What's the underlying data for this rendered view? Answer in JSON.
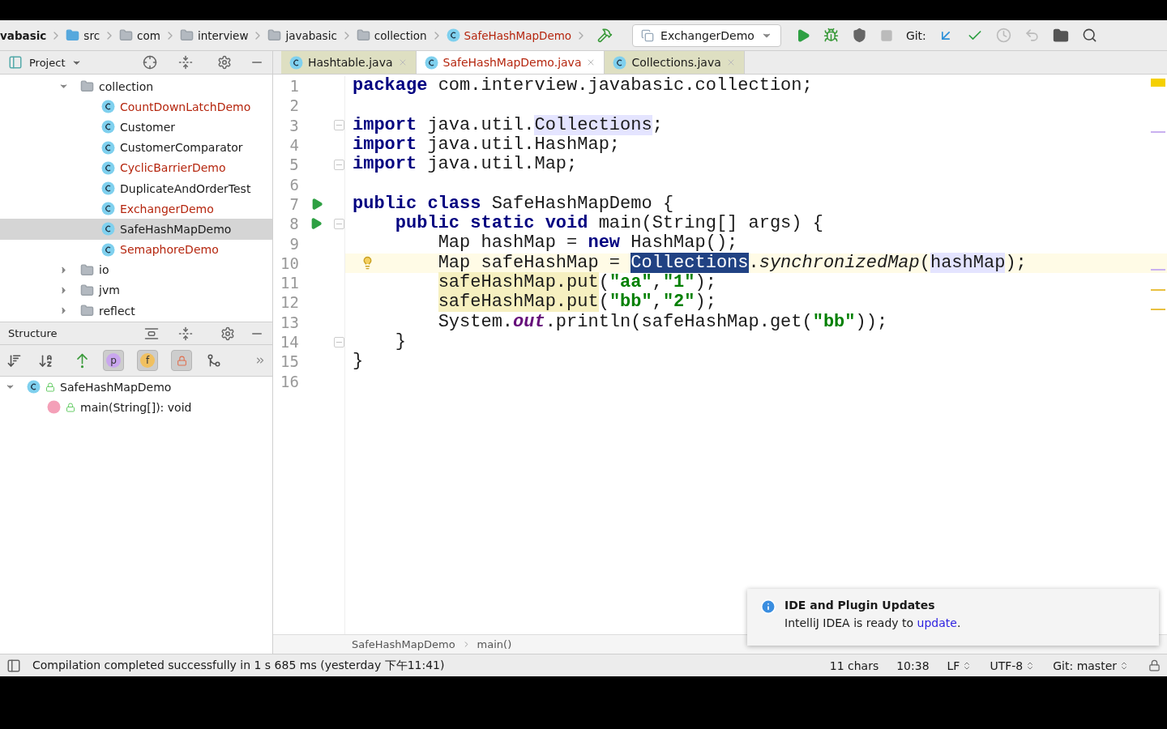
{
  "breadcrumbs": [
    {
      "label": "vabasic",
      "kind": "module"
    },
    {
      "label": "src",
      "kind": "source-folder"
    },
    {
      "label": "com",
      "kind": "package"
    },
    {
      "label": "interview",
      "kind": "package"
    },
    {
      "label": "javabasic",
      "kind": "package"
    },
    {
      "label": "collection",
      "kind": "package"
    },
    {
      "label": "SafeHashMapDemo",
      "kind": "class"
    }
  ],
  "run_config": "ExchangerDemo",
  "git_label": "Git:",
  "project_panel": {
    "title": "Project",
    "tree": [
      {
        "label": "collection",
        "expanded": true,
        "children": [
          {
            "label": "CountDownLatchDemo",
            "color": "#b5260e",
            "selected": false
          },
          {
            "label": "Customer",
            "color": "#1a1a1a",
            "selected": false
          },
          {
            "label": "CustomerComparator",
            "color": "#1a1a1a",
            "selected": false
          },
          {
            "label": "CyclicBarrierDemo",
            "color": "#b5260e",
            "selected": false
          },
          {
            "label": "DuplicateAndOrderTest",
            "color": "#1a1a1a",
            "selected": false
          },
          {
            "label": "ExchangerDemo",
            "color": "#b5260e",
            "selected": false
          },
          {
            "label": "SafeHashMapDemo",
            "color": "#1a1a1a",
            "selected": true
          },
          {
            "label": "SemaphoreDemo",
            "color": "#b5260e",
            "selected": false
          }
        ]
      },
      {
        "label": "io",
        "expanded": false
      },
      {
        "label": "jvm",
        "expanded": false
      },
      {
        "label": "reflect",
        "expanded": false
      }
    ]
  },
  "structure_panel": {
    "title": "Structure",
    "filters": [
      {
        "kind": "p",
        "label": "p",
        "on": true
      },
      {
        "kind": "f",
        "label": "f",
        "on": true
      },
      {
        "kind": "lock",
        "on": true
      }
    ],
    "tree": [
      {
        "label": "SafeHashMapDemo",
        "kind": "class",
        "expanded": true,
        "children": [
          {
            "label": "main(String[]): void",
            "kind": "method"
          }
        ]
      }
    ]
  },
  "tabs": [
    {
      "label": "Hashtable.java",
      "selected": false,
      "color": "#1a1a1a"
    },
    {
      "label": "SafeHashMapDemo.java",
      "selected": true,
      "color": "#b5260e"
    },
    {
      "label": "Collections.java",
      "selected": false,
      "color": "#1a1a1a"
    }
  ],
  "editor": {
    "lines": [
      {
        "n": "1",
        "current": false,
        "fold": false,
        "tokens": [
          {
            "text": "package",
            "kind": "keyword"
          },
          {
            "text": " com.interview.javabasic.collection;",
            "kind": "plain"
          }
        ]
      },
      {
        "n": "2",
        "current": false,
        "fold": false
      },
      {
        "n": "3",
        "current": false,
        "fold": true,
        "tokens": [
          {
            "text": "import",
            "kind": "keyword"
          },
          {
            "text": " java.util.",
            "kind": "plain"
          },
          {
            "text": "Collections",
            "kind": "usage"
          },
          {
            "text": ";",
            "kind": "plain"
          }
        ]
      },
      {
        "n": "4",
        "current": false,
        "fold": false,
        "tokens": [
          {
            "text": "import",
            "kind": "keyword"
          },
          {
            "text": " java.util.HashMap;",
            "kind": "plain"
          }
        ]
      },
      {
        "n": "5",
        "current": false,
        "fold": true,
        "tokens": [
          {
            "text": "import",
            "kind": "keyword"
          },
          {
            "text": " java.util.Map;",
            "kind": "plain"
          }
        ]
      },
      {
        "n": "6",
        "current": false,
        "fold": false
      },
      {
        "n": "7",
        "current": false,
        "fold": false,
        "kind": "run",
        "tokens": [
          {
            "text": "public class",
            "kind": "keyword"
          },
          {
            "text": " SafeHashMapDemo {",
            "kind": "plain"
          }
        ]
      },
      {
        "n": "8",
        "current": false,
        "fold": true,
        "kind": "run",
        "tokens": [
          {
            "text": "    public static void",
            "kind": "keyword"
          },
          {
            "text": " main(String[] args) {",
            "kind": "plain"
          }
        ]
      },
      {
        "n": "9",
        "current": false,
        "fold": false,
        "tokens": [
          {
            "text": "        Map hashMap = ",
            "kind": "plain"
          },
          {
            "text": "new",
            "kind": "keyword"
          },
          {
            "text": " HashMap();",
            "kind": "plain"
          }
        ]
      },
      {
        "n": "10",
        "current": true,
        "fold": false,
        "kind": "bulb",
        "tokens": [
          {
            "text": "        Map safeHashMap = ",
            "kind": "plain"
          },
          {
            "text": "Collections",
            "kind": "selection"
          },
          {
            "text": ".",
            "kind": "plain"
          },
          {
            "text": "synchronizedMap",
            "kind": "italic"
          },
          {
            "text": "(",
            "kind": "plain"
          },
          {
            "text": "hashMap",
            "kind": "usage"
          },
          {
            "text": ");",
            "kind": "plain"
          }
        ]
      },
      {
        "n": "11",
        "current": false,
        "fold": false,
        "tokens": [
          {
            "text": "        safeHashMap.put",
            "kind": "write"
          },
          {
            "text": "(",
            "kind": "plain"
          },
          {
            "text": "\"aa\"",
            "kind": "string"
          },
          {
            "text": ",",
            "kind": "plain"
          },
          {
            "text": "\"1\"",
            "kind": "string"
          },
          {
            "text": ");",
            "kind": "plain"
          }
        ]
      },
      {
        "n": "12",
        "current": false,
        "fold": false,
        "tokens": [
          {
            "text": "        safeHashMap.put",
            "kind": "write"
          },
          {
            "text": "(",
            "kind": "plain"
          },
          {
            "text": "\"bb\"",
            "kind": "string"
          },
          {
            "text": ",",
            "kind": "plain"
          },
          {
            "text": "\"2\"",
            "kind": "string"
          },
          {
            "text": ");",
            "kind": "plain"
          }
        ]
      },
      {
        "n": "13",
        "current": false,
        "fold": false,
        "tokens": [
          {
            "text": "        System.",
            "kind": "plain"
          },
          {
            "text": "out",
            "kind": "static"
          },
          {
            "text": ".println(safeHashMap.get(",
            "kind": "plain"
          },
          {
            "text": "\"bb\"",
            "kind": "string"
          },
          {
            "text": "));",
            "kind": "plain"
          }
        ]
      },
      {
        "n": "14",
        "current": false,
        "fold": true,
        "tokens": [
          {
            "text": "    }",
            "kind": "plain"
          }
        ]
      },
      {
        "n": "15",
        "current": false,
        "fold": false,
        "tokens": [
          {
            "text": "}",
            "kind": "plain"
          }
        ]
      },
      {
        "n": "16",
        "current": false,
        "fold": false
      }
    ],
    "breadcrumb": [
      "SafeHashMapDemo",
      "main()"
    ]
  },
  "notification": {
    "title": "IDE and Plugin Updates",
    "text": "IntelliJ IDEA is ready to ",
    "link": "update",
    "after": "."
  },
  "status_bar": {
    "message": "Compilation completed successfully in 1 s 685 ms (yesterday 下午11:41)",
    "items": [
      {
        "label": "11 chars",
        "kind": "text"
      },
      {
        "label": "10:38",
        "kind": "text"
      },
      {
        "label": "LF",
        "kind": "picker"
      },
      {
        "label": "UTF-8",
        "kind": "picker"
      },
      {
        "label": "Git: master",
        "kind": "picker"
      }
    ]
  }
}
